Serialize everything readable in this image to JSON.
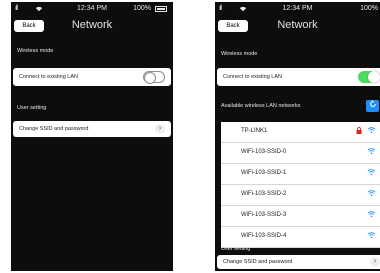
{
  "status": {
    "signal": "ıll",
    "time": "12:34 PM",
    "battery": "100%"
  },
  "nav": {
    "back_label": "Back",
    "title": "Network"
  },
  "left": {
    "wireless_mode_label": "Wireless mode",
    "connect_label": "Connect to existing LAN",
    "connect_enabled": false,
    "user_setting_label": "User setting",
    "change_label": "Change SSID and password"
  },
  "right": {
    "wireless_mode_label": "Wireless mode",
    "connect_label": "Connect to existing LAN",
    "connect_enabled": true,
    "available_label": "Available wireless LAN networks",
    "networks": [
      {
        "name": "TP-LINK1",
        "locked": true
      },
      {
        "name": "WiFi-103-SSID-0",
        "locked": false
      },
      {
        "name": "WiFi-103-SSID-1",
        "locked": false
      },
      {
        "name": "WiFi-103-SSID-2",
        "locked": false
      },
      {
        "name": "WiFi-103-SSID-3",
        "locked": false
      },
      {
        "name": "WiFi-103-SSID-4",
        "locked": false
      }
    ],
    "user_setting_label": "User setting",
    "change_label": "Change SSID and password"
  },
  "icons": {
    "wifi": "wifi-icon",
    "lock": "lock-icon",
    "refresh": "refresh-icon",
    "chevron": "chevron-right-icon"
  },
  "colors": {
    "background": "#0d0d0d",
    "toggle_on": "#4cd964",
    "accent": "#1e8fff",
    "lock": "#e02020"
  }
}
